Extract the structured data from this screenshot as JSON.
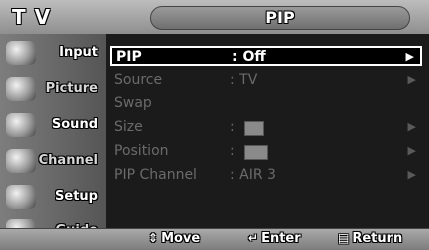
{
  "header": {
    "source_label": "T V",
    "title": "PIP"
  },
  "sidebar": {
    "items": [
      {
        "label": "Input",
        "icon": "input-icon",
        "active": true
      },
      {
        "label": "Picture",
        "icon": "picture-icon",
        "active": false
      },
      {
        "label": "Sound",
        "icon": "sound-icon",
        "active": true
      },
      {
        "label": "Channel",
        "icon": "channel-icon",
        "active": false
      },
      {
        "label": "Setup",
        "icon": "setup-icon",
        "active": true
      },
      {
        "label": "Guide",
        "icon": "guide-icon",
        "active": false
      }
    ]
  },
  "menu": {
    "rows": [
      {
        "label": "PIP",
        "value": ": Off",
        "selected": true
      },
      {
        "label": "Source",
        "value": ": TV",
        "selected": false
      },
      {
        "label": "Swap",
        "value": "",
        "selected": false
      },
      {
        "label": "Size",
        "value": ":",
        "selected": false
      },
      {
        "label": "Position",
        "value": ":",
        "selected": false
      },
      {
        "label": "PIP Channel",
        "value": ": AIR 3",
        "selected": false
      }
    ]
  },
  "footer": {
    "move_icon": "updown-arrow-icon",
    "move": "Move",
    "enter_icon": "enter-icon",
    "enter": "Enter",
    "return_icon": "return-icon",
    "return": "Return"
  },
  "colors": {
    "highlight_border": "#ffffff",
    "dim_text": "#6b6b6b"
  }
}
